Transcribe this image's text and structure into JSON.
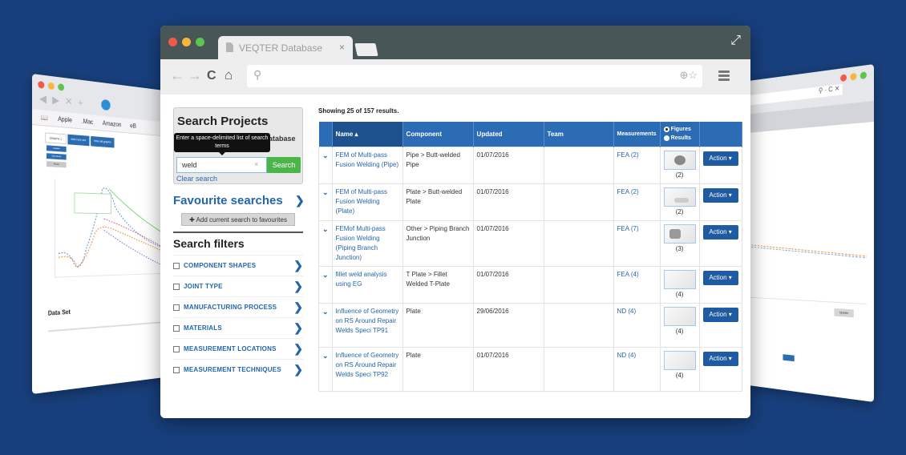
{
  "colors": {
    "background": "#183f7d",
    "accent": "#2c6cb5",
    "link": "#2465ad",
    "search_button": "#4cb54a",
    "action_button": "#1e5ba3",
    "traffic_red": "#f05a4a",
    "traffic_yellow": "#f6b73c",
    "traffic_green": "#5cc64c"
  },
  "back_left_window": {
    "bookmarks": [
      "Apple",
      ".Mac",
      "Amazon",
      "eB"
    ],
    "tabs": [
      "GRAPH 1",
      "Add new set",
      "Hide all graphs"
    ],
    "buttons": [
      "Update",
      "Download",
      "Reset"
    ],
    "section_title": "Data Set"
  },
  "main_window": {
    "tab_title": "VEQTER Database",
    "tab_close": "×",
    "icons": {
      "back": "←",
      "forward": "→",
      "reload": "C",
      "home": "⌂",
      "search": "⚲",
      "zoom_star": "⊕☆",
      "fullscreen": "⤢"
    }
  },
  "sidebar": {
    "search_title": "Search Projects",
    "search_subtitle": "atabase",
    "tooltip": "Enter a space-delimited list of search terms",
    "search_value": "weld",
    "search_clear": "×",
    "search_button": "Search",
    "clear_search": "Clear search",
    "favourites_title": "Favourite searches",
    "add_favourite": "✚ Add current search to favourites",
    "filters_title": "Search filters",
    "filters": [
      {
        "label": "COMPONENT SHAPES"
      },
      {
        "label": "JOINT TYPE"
      },
      {
        "label": "MANUFACTURING PROCESS"
      },
      {
        "label": "MATERIALS"
      },
      {
        "label": "MEASUREMENT LOCATIONS"
      },
      {
        "label": "MEASUREMENT TECHNIQUES"
      }
    ]
  },
  "results": {
    "summary": "Showing 25 of 157 results.",
    "columns": {
      "name": "Name ▴",
      "component": "Component",
      "updated": "Updated",
      "team": "Team",
      "measurements": "Measurements",
      "figures": "Figures",
      "results": "Results"
    },
    "rows": [
      {
        "name": "FEM of Multi-pass Fusion Welding (Pipe)",
        "component": "Pipe > Butt-welded Pipe",
        "updated": "01/07/2016",
        "team": "",
        "measurements": "FEA (2)",
        "figures": "(2)",
        "action": "Action ▾"
      },
      {
        "name": "FEM of Multi-pass Fusion Welding (Plate)",
        "component": "Plate > Butt-welded Plate",
        "updated": "01/07/2016",
        "team": "",
        "measurements": "FEA (2)",
        "figures": "(2)",
        "action": "Action ▾"
      },
      {
        "name": "FEMof Multi-pass Fusion Welding (Piping Branch Junction)",
        "component": "Other > Piping Branch Junction",
        "updated": "01/07/2016",
        "team": "",
        "measurements": "FEA (7)",
        "figures": "(3)",
        "action": "Action ▾"
      },
      {
        "name": "fillet weld analysis using EG",
        "component": "T Plate > Fillet Welded T-Plate",
        "updated": "01/07/2016",
        "team": "",
        "measurements": "FEA (4)",
        "figures": "(4)",
        "action": "Action ▾"
      },
      {
        "name": "Influence of Geometry on RS Around Repair Welds Speci TP91",
        "component": "Plate",
        "updated": "29/06/2016",
        "team": "",
        "measurements": "ND (4)",
        "figures": "(4)",
        "action": "Action ▾"
      },
      {
        "name": "Influence of Geometry on RS Around Repair Welds Speci TP92",
        "component": "Plate",
        "updated": "01/07/2016",
        "team": "",
        "measurements": "ND (4)",
        "figures": "(4)",
        "action": "Action ▾"
      }
    ]
  },
  "back_right_window": {
    "button": "Update"
  }
}
